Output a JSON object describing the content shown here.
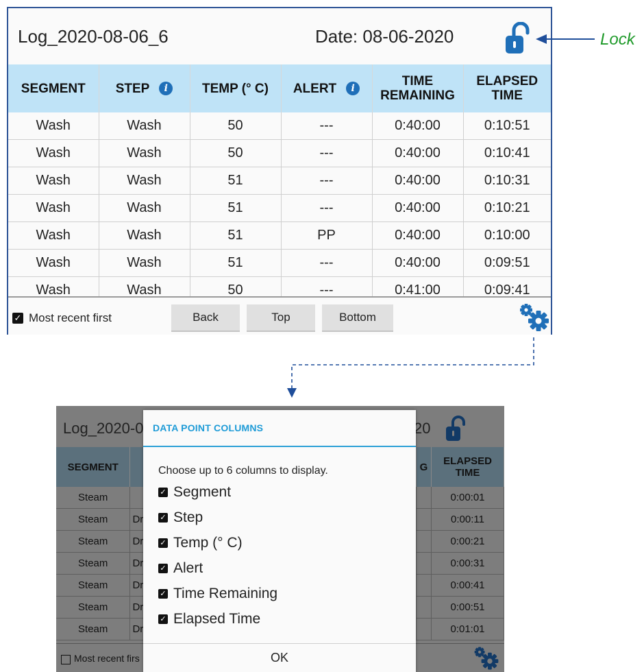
{
  "top_panel": {
    "title": "Log_2020-08-06_6",
    "date": "Date: 08-06-2020",
    "columns": [
      "SEGMENT",
      "STEP",
      "TEMP (° C)",
      "ALERT",
      "TIME\nREMAINING",
      "ELAPSED\nTIME"
    ],
    "rows": [
      [
        "Wash",
        "Wash",
        "50",
        "---",
        "0:40:00",
        "0:10:51"
      ],
      [
        "Wash",
        "Wash",
        "50",
        "---",
        "0:40:00",
        "0:10:41"
      ],
      [
        "Wash",
        "Wash",
        "51",
        "---",
        "0:40:00",
        "0:10:31"
      ],
      [
        "Wash",
        "Wash",
        "51",
        "---",
        "0:40:00",
        "0:10:21"
      ],
      [
        "Wash",
        "Wash",
        "51",
        "PP",
        "0:40:00",
        "0:10:00"
      ],
      [
        "Wash",
        "Wash",
        "51",
        "---",
        "0:40:00",
        "0:09:51"
      ],
      [
        "Wash",
        "Wash",
        "50",
        "---",
        "0:41:00",
        "0:09:41"
      ]
    ],
    "most_recent_label": "Most recent first",
    "most_recent_checked": true,
    "buttons": {
      "back": "Back",
      "top": "Top",
      "bottom": "Bottom"
    }
  },
  "annotation": {
    "lock_label": "Lock"
  },
  "bottom_panel": {
    "title_left": "Log_2020-0",
    "title_right": "20",
    "header_segment": "SEGMENT",
    "header_partial": "G",
    "header_elapsed": "ELAPSED\nTIME",
    "rows": [
      {
        "segment": "Steam",
        "step": "",
        "elapsed": "0:00:01"
      },
      {
        "segment": "Steam",
        "step": "Dr",
        "elapsed": "0:00:11"
      },
      {
        "segment": "Steam",
        "step": "Dr",
        "elapsed": "0:00:21"
      },
      {
        "segment": "Steam",
        "step": "Dr",
        "elapsed": "0:00:31"
      },
      {
        "segment": "Steam",
        "step": "Dr",
        "elapsed": "0:00:41"
      },
      {
        "segment": "Steam",
        "step": "Dr",
        "elapsed": "0:00:51"
      },
      {
        "segment": "Steam",
        "step": "Dr",
        "elapsed": "0:01:01"
      }
    ],
    "most_recent_label": "Most recent firs",
    "dialog": {
      "title": "DATA POINT COLUMNS",
      "description": "Choose up to 6 columns to display.",
      "options": [
        {
          "label": "Segment",
          "checked": true
        },
        {
          "label": "Step",
          "checked": true
        },
        {
          "label": "Temp (° C)",
          "checked": true
        },
        {
          "label": "Alert",
          "checked": true
        },
        {
          "label": "Time Remaining",
          "checked": true
        },
        {
          "label": "Elapsed Time",
          "checked": true
        }
      ],
      "ok_label": "OK"
    }
  },
  "colors": {
    "panel_border": "#2f5597",
    "header_bg": "#bfe3f7",
    "lock_blue": "#1f6fb8",
    "annotation_green": "#1f9a2a",
    "dialog_accent": "#1e9bd7"
  }
}
